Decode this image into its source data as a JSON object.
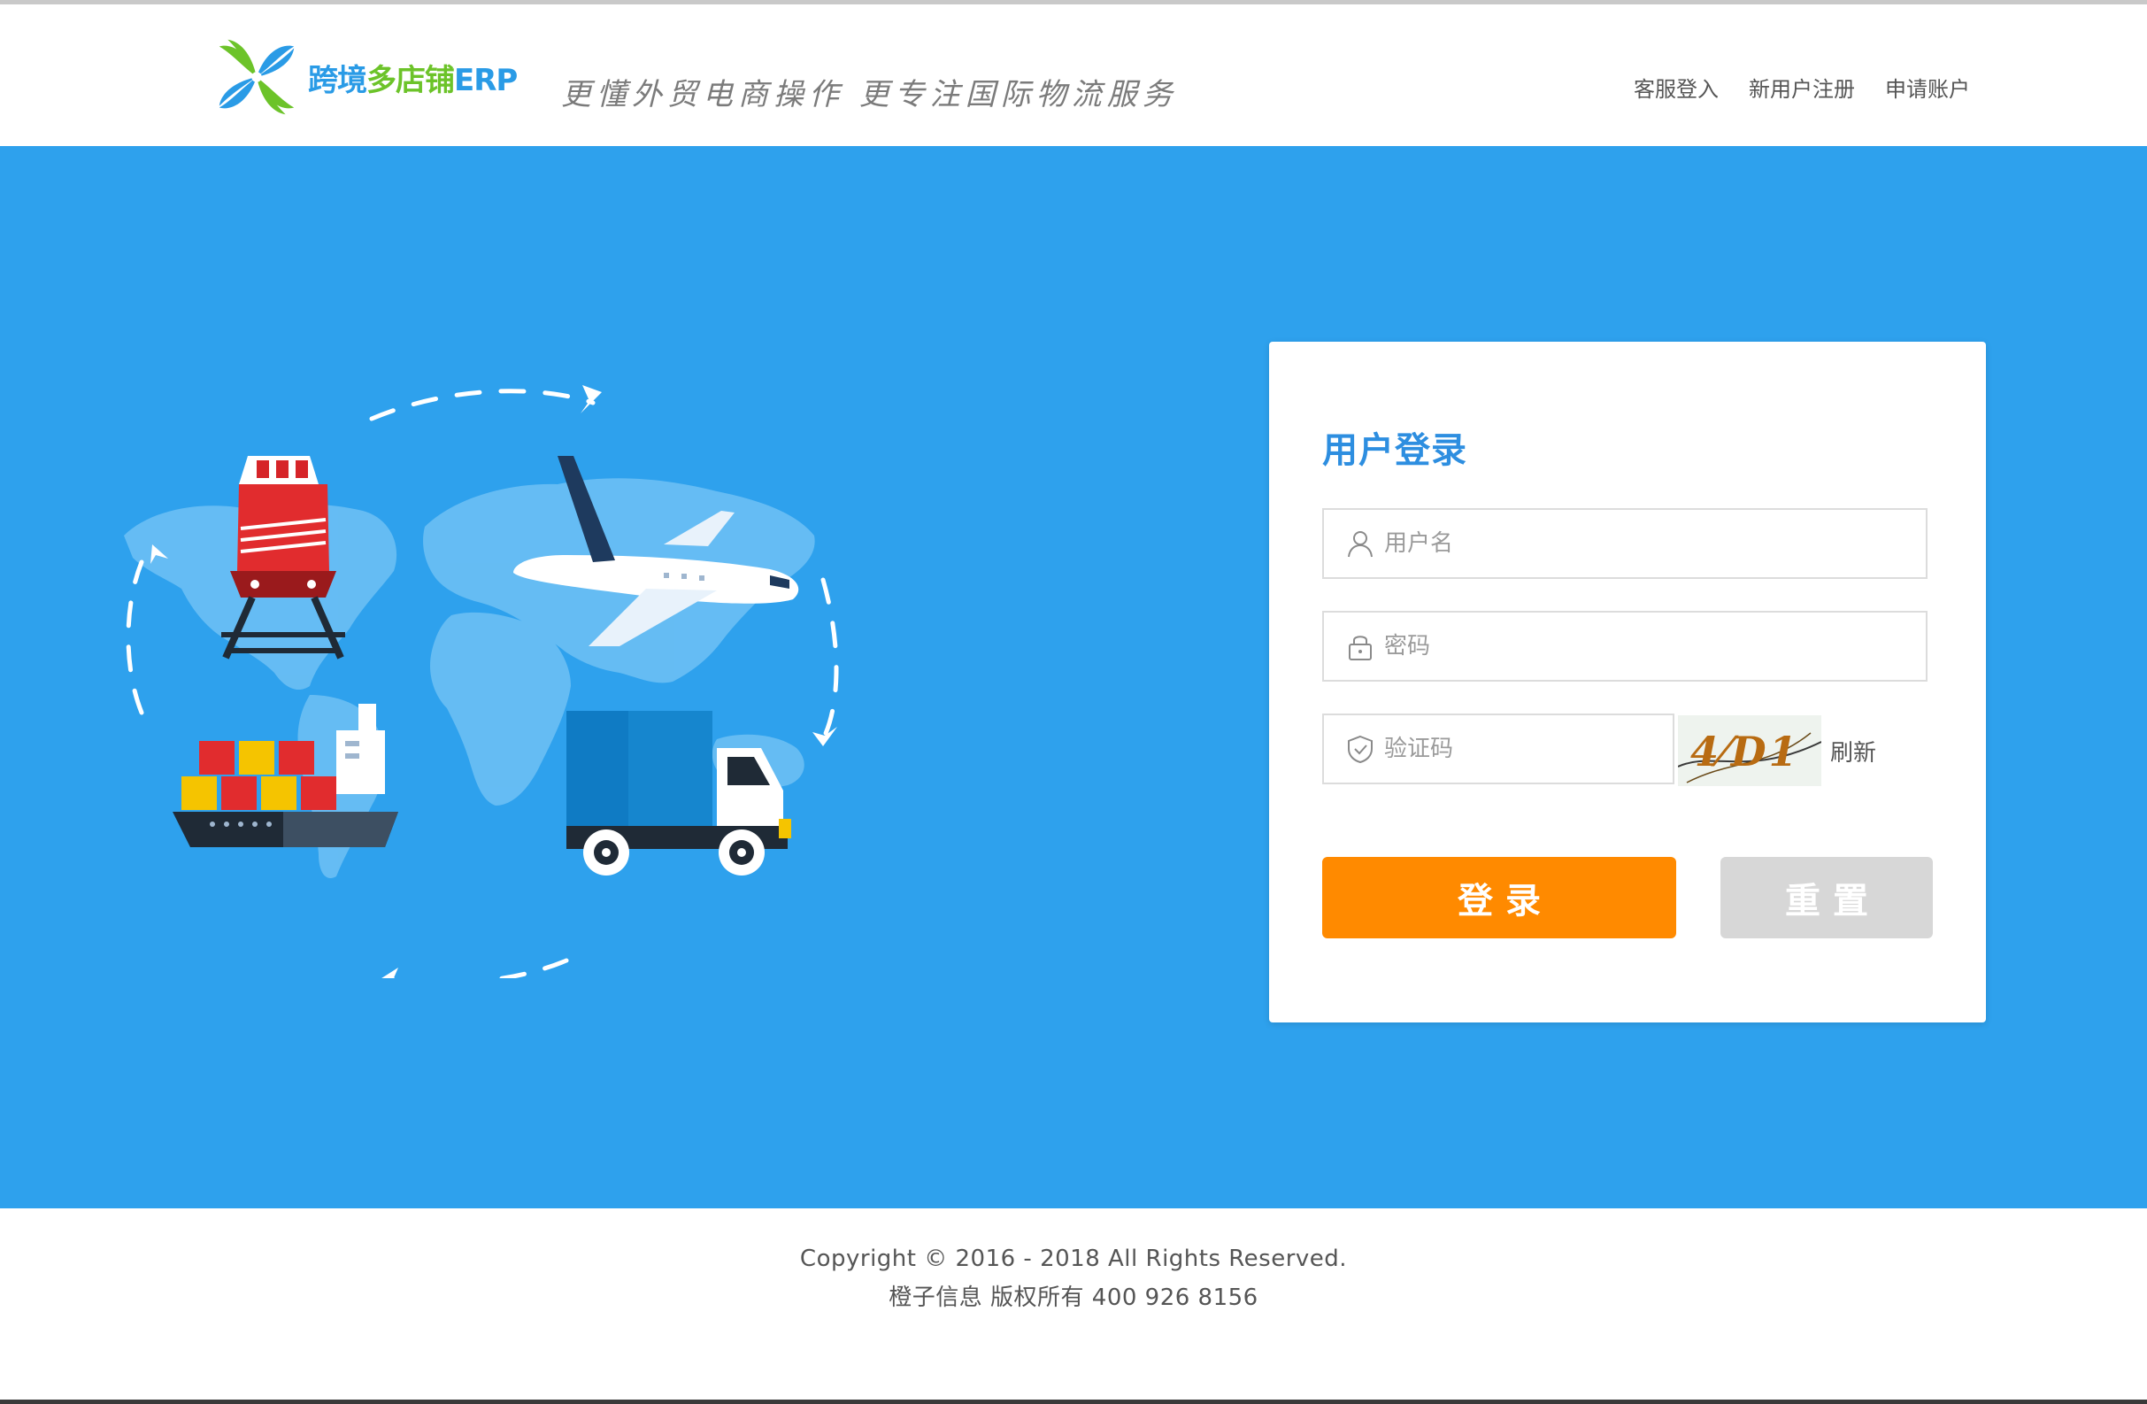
{
  "header": {
    "brand": {
      "part1": "跨境",
      "part2": "多店铺",
      "part3": "ERP"
    },
    "slogan": "更懂外贸电商操作 更专注国际物流服务",
    "nav": [
      {
        "label": "客服登入"
      },
      {
        "label": "新用户注册"
      },
      {
        "label": "申请账户"
      }
    ]
  },
  "login": {
    "title": "用户登录",
    "username_placeholder": "用户名",
    "password_placeholder": "密码",
    "captcha_placeholder": "验证码",
    "captcha_text": "4⁄D1",
    "refresh_label": "刷新",
    "login_label": "登录",
    "reset_label": "重置"
  },
  "footer": {
    "copyright": "Copyright © 2016 - 2018 All Rights Reserved.",
    "company": "橙子信息 版权所有 400 926 8156"
  },
  "colors": {
    "hero_bg": "#2ea1ed",
    "title_blue": "#2d8ee0",
    "login_orange": "#ff8a00",
    "reset_gray": "#d7d7d7",
    "brand_green": "#6cc329"
  },
  "icons": {
    "logo": "pinwheel-logo-icon",
    "username": "user-icon",
    "password": "lock-icon",
    "captcha": "shield-check-icon"
  }
}
